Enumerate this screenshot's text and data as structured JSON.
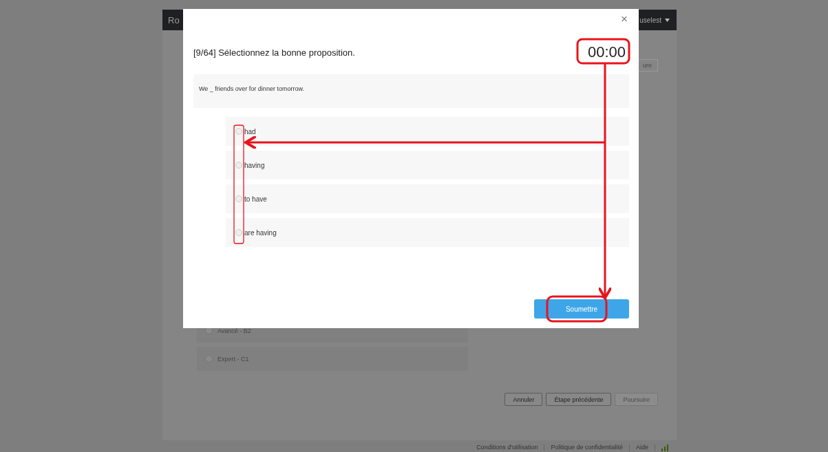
{
  "background_page": {
    "header": {
      "brand": "Ro",
      "user_menu": "uselest"
    },
    "side_button": "ure",
    "levels": [
      {
        "label": "Avancé - B2",
        "selected": false
      },
      {
        "label": "Expert - C1",
        "selected": false
      }
    ],
    "buttons": [
      {
        "label": "Annuler",
        "disabled": false
      },
      {
        "label": "Étape précédente",
        "disabled": false
      },
      {
        "label": "Poursuire",
        "disabled": true
      }
    ],
    "footer_links": [
      "Conditions d'utilisation",
      "Politique de confidentialité",
      "Aide"
    ]
  },
  "dialog": {
    "close": "×",
    "title": "[9/64] Sélectionnez la bonne proposition.",
    "timer": "00:00",
    "prompt": "We _ friends over for dinner tomorrow.",
    "options": [
      {
        "label": "had",
        "selected": false
      },
      {
        "label": "having",
        "selected": false
      },
      {
        "label": "to have",
        "selected": false
      },
      {
        "label": "are having",
        "selected": false
      }
    ],
    "submit": "Soumettre"
  }
}
